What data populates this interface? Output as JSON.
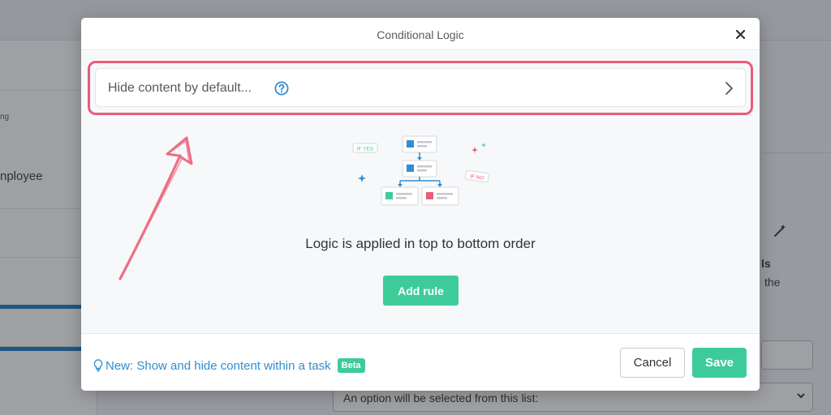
{
  "background": {
    "sidebar_small": "ng",
    "sidebar_text": "nployee",
    "right_text_bold": "ls",
    "right_text": "the",
    "select_value": "An option will be selected from this list:"
  },
  "modal": {
    "title": "Conditional Logic",
    "close_label": "×",
    "default_row": {
      "label": "Hide content by default...",
      "help_icon": "question-circle-icon",
      "chevron_icon": "chevron-right-icon"
    },
    "illustration": {
      "if_yes": "IF YES",
      "if_no": "IF NO"
    },
    "logic_text": "Logic is applied in top to bottom order",
    "add_rule_label": "Add rule",
    "footer": {
      "tip_text": "New: Show and hide content within a task",
      "beta_badge": "Beta",
      "cancel_label": "Cancel",
      "save_label": "Save"
    }
  },
  "colors": {
    "accent_green": "#3ecb9a",
    "link_blue": "#2f8fd1",
    "highlight_pink": "#e95c78",
    "progress_blue": "#1d78c4"
  }
}
